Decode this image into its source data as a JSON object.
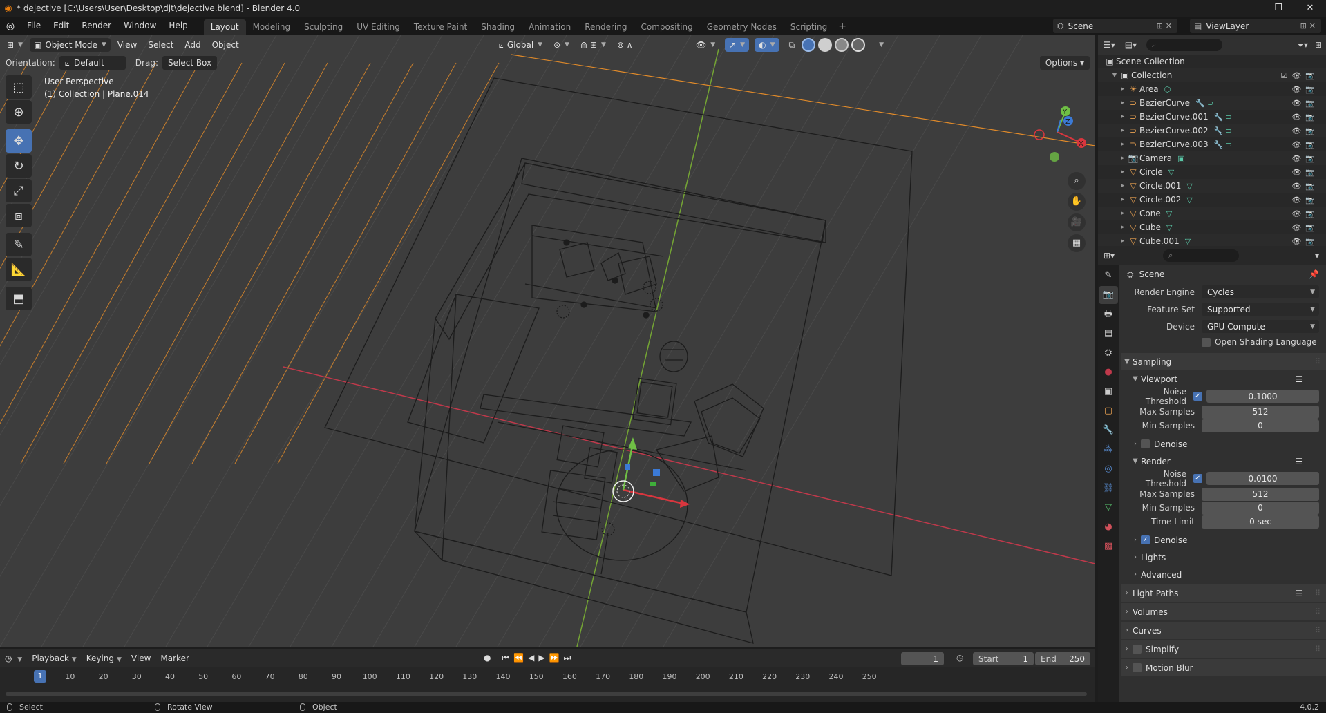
{
  "window": {
    "title": "* dejective [C:\\Users\\User\\Desktop\\djt\\dejective.blend] - Blender 4.0",
    "controls": [
      "–",
      "❐",
      "✕"
    ]
  },
  "topbar": {
    "menus": [
      "File",
      "Edit",
      "Render",
      "Window",
      "Help"
    ],
    "workspaces": [
      "Layout",
      "Modeling",
      "Sculpting",
      "UV Editing",
      "Texture Paint",
      "Shading",
      "Animation",
      "Rendering",
      "Compositing",
      "Geometry Nodes",
      "Scripting"
    ],
    "active_workspace": "Layout",
    "add_workspace": "+",
    "scene": "Scene",
    "view_layer": "ViewLayer"
  },
  "viewport": {
    "mode": "Object Mode",
    "menus": [
      "View",
      "Select",
      "Add",
      "Object"
    ],
    "transform_orientation": "Global",
    "tool_settings": {
      "orientation_label": "Orientation:",
      "orientation_value": "Default",
      "drag_label": "Drag:",
      "drag_value": "Select Box",
      "options_label": "Options"
    },
    "info_line1": "User Perspective",
    "info_line2": "(1) Collection | Plane.014",
    "gizmo_axes": [
      "X",
      "Y",
      "Z"
    ],
    "colors": {
      "background": "#3d3d3d",
      "grid": "#4a4a4a",
      "wire": "#1a1a1a",
      "x_axis": "#c0394b",
      "y_axis": "#74a534",
      "light_lines": "#e08a2a",
      "active": "#4772b3"
    },
    "tools": [
      "select-box",
      "cursor",
      "move",
      "rotate",
      "scale",
      "transform",
      "annotate",
      "measure",
      "add-cube"
    ],
    "active_tool": "move"
  },
  "outliner": {
    "root": "Scene Collection",
    "collection": "Collection",
    "items": [
      {
        "name": "Area",
        "icon": "light-icon",
        "extra": "light-data-icon"
      },
      {
        "name": "BezierCurve",
        "icon": "curve-icon",
        "extra": "modifier-icon"
      },
      {
        "name": "BezierCurve.001",
        "icon": "curve-icon",
        "extra": "modifier-icon"
      },
      {
        "name": "BezierCurve.002",
        "icon": "curve-icon",
        "extra": "modifier-icon"
      },
      {
        "name": "BezierCurve.003",
        "icon": "curve-icon",
        "extra": "modifier-icon"
      },
      {
        "name": "Camera",
        "icon": "camera-icon",
        "extra": "camera-data-icon"
      },
      {
        "name": "Circle",
        "icon": "mesh-icon",
        "extra": "mesh-data-icon"
      },
      {
        "name": "Circle.001",
        "icon": "mesh-icon",
        "extra": "mesh-data-icon"
      },
      {
        "name": "Circle.002",
        "icon": "mesh-icon",
        "extra": "mesh-data-icon"
      },
      {
        "name": "Cone",
        "icon": "mesh-icon",
        "extra": "mesh-data-icon"
      },
      {
        "name": "Cube",
        "icon": "mesh-icon",
        "extra": "mesh-data-icon"
      },
      {
        "name": "Cube.001",
        "icon": "mesh-icon",
        "extra": "mesh-data-icon"
      }
    ]
  },
  "properties": {
    "context": "Scene",
    "render_engine_label": "Render Engine",
    "render_engine": "Cycles",
    "feature_set_label": "Feature Set",
    "feature_set": "Supported",
    "device_label": "Device",
    "device": "GPU Compute",
    "osl_label": "Open Shading Language",
    "sampling": "Sampling",
    "viewport_label": "Viewport",
    "render_label": "Render",
    "noise_threshold_label": "Noise Threshold",
    "max_samples_label": "Max Samples",
    "min_samples_label": "Min Samples",
    "time_limit_label": "Time Limit",
    "denoise_label": "Denoise",
    "viewport_noise_threshold": "0.1000",
    "viewport_max_samples": "512",
    "viewport_min_samples": "0",
    "render_noise_threshold": "0.0100",
    "render_max_samples": "512",
    "render_min_samples": "0",
    "render_time_limit": "0 sec",
    "panels_after": [
      "Lights",
      "Advanced"
    ],
    "top_panels": [
      "Light Paths",
      "Volumes",
      "Curves",
      "Simplify",
      "Motion Blur"
    ]
  },
  "timeline": {
    "menus": [
      "Playback",
      "Keying",
      "View",
      "Marker"
    ],
    "current_frame": "1",
    "start_label": "Start",
    "start": "1",
    "end_label": "End",
    "end": "250",
    "ticks": [
      "10",
      "20",
      "30",
      "40",
      "50",
      "60",
      "70",
      "80",
      "90",
      "100",
      "110",
      "120",
      "130",
      "140",
      "150",
      "160",
      "170",
      "180",
      "190",
      "200",
      "210",
      "220",
      "230",
      "240",
      "250"
    ]
  },
  "statusbar": {
    "select": "Select",
    "rotate_view": "Rotate View",
    "object": "Object",
    "version": "4.0.2"
  }
}
